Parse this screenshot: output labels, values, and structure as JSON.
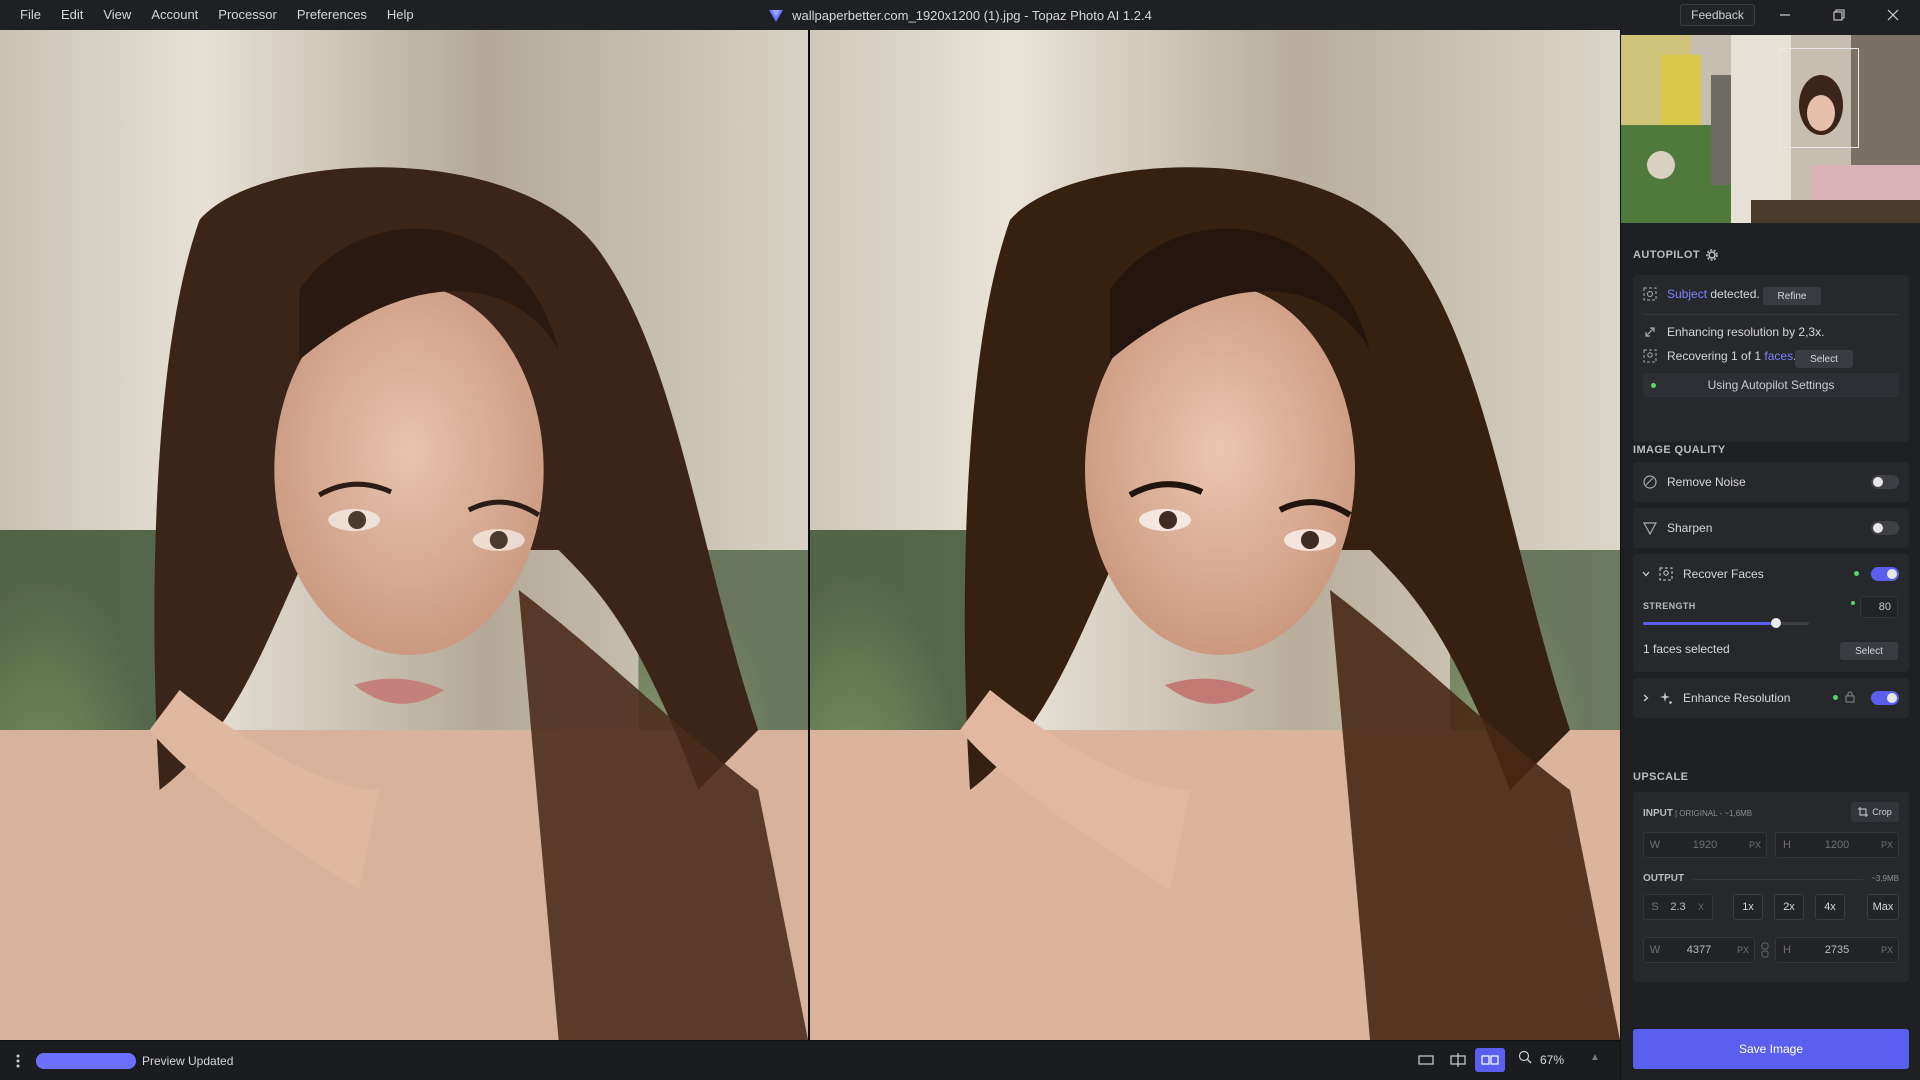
{
  "menu": [
    "File",
    "Edit",
    "View",
    "Account",
    "Processor",
    "Preferences",
    "Help"
  ],
  "window": {
    "title": "wallpaperbetter.com_1920x1200 (1).jpg - Topaz Photo AI 1.2.4",
    "feedback": "Feedback"
  },
  "colors": {
    "accent": "#5a5ff0",
    "link": "#7d83ff",
    "active_dot": "#5bd46b",
    "panel_bg": "#1f2023"
  },
  "autopilot": {
    "title": "AUTOPILOT",
    "subject_link": "Subject",
    "subject_text": " detected.",
    "refine": "Refine",
    "enhancing": "Enhancing resolution by 2,3x.",
    "recovering_pre": "Recovering 1 of 1 ",
    "recovering_link": "faces",
    "recovering_post": ".",
    "select": "Select",
    "settings": "Using Autopilot Settings"
  },
  "image_quality": {
    "title": "IMAGE QUALITY",
    "remove_noise": {
      "label": "Remove Noise",
      "enabled": false
    },
    "sharpen": {
      "label": "Sharpen",
      "enabled": false
    },
    "recover_faces": {
      "label": "Recover Faces",
      "enabled": true,
      "strength_label": "STRENGTH",
      "strength": "80",
      "strength_fraction": 0.8,
      "faces_selected": "1 faces selected",
      "select": "Select"
    },
    "enhance_resolution": {
      "label": "Enhance Resolution",
      "enabled": true
    }
  },
  "upscale": {
    "title": "UPSCALE",
    "input_label": "INPUT",
    "input_info": "| ORIGINAL - ~1,6MB",
    "crop": "Crop",
    "input_w": "1920",
    "input_h": "1200",
    "output_label": "OUTPUT",
    "output_size": "~3,9MB",
    "scale_label": "S",
    "scale": "2.3",
    "scale_unit": "X",
    "multipliers": [
      "1x",
      "2x",
      "4x",
      "Max"
    ],
    "output_w": "4377",
    "output_h": "2735",
    "w_label": "W",
    "h_label": "H",
    "px": "PX"
  },
  "save": "Save Image",
  "status": {
    "text": "Preview Updated",
    "progress": 1.0
  },
  "zoom": "67%"
}
